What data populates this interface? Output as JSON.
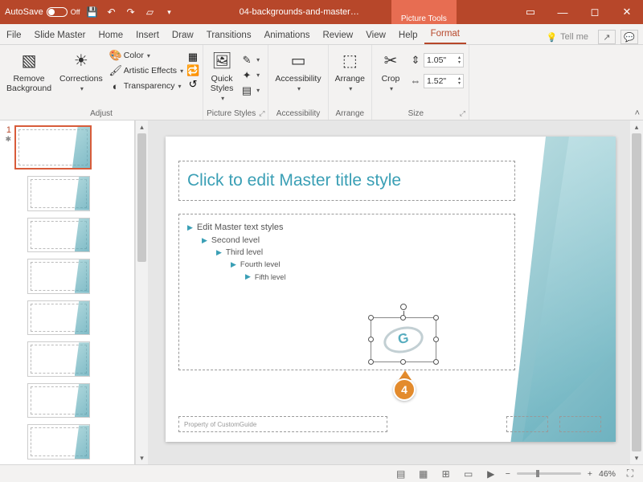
{
  "titlebar": {
    "autosave_label": "AutoSave",
    "autosave_state": "Off",
    "doc_title": "04-backgrounds-and-master…",
    "context_tool": "Picture Tools"
  },
  "tabs": {
    "items": [
      "File",
      "Slide Master",
      "Home",
      "Insert",
      "Draw",
      "Transitions",
      "Animations",
      "Review",
      "View",
      "Help",
      "Format"
    ],
    "active": "Format",
    "tellme": "Tell me"
  },
  "ribbon": {
    "adjust": {
      "remove_bg": "Remove\nBackground",
      "corrections": "Corrections",
      "color": "Color",
      "artistic": "Artistic Effects",
      "transparency": "Transparency",
      "label": "Adjust"
    },
    "picture_styles": {
      "quick_styles": "Quick\nStyles",
      "label": "Picture Styles"
    },
    "accessibility": {
      "label": "Accessibility"
    },
    "arrange": {
      "label": "Arrange"
    },
    "size": {
      "crop": "Crop",
      "height": "1.05\"",
      "width": "1.52\"",
      "label": "Size"
    }
  },
  "thumbnails": {
    "master_index": "1"
  },
  "slide": {
    "title_placeholder": "Click to edit Master title style",
    "bullets": {
      "l1": "Edit Master text styles",
      "l2": "Second level",
      "l3": "Third level",
      "l4": "Fourth level",
      "l5": "Fifth level"
    },
    "footer_text": "Property of CustomGuide",
    "callout_number": "4"
  },
  "statusbar": {
    "zoom_pct": "46%"
  }
}
